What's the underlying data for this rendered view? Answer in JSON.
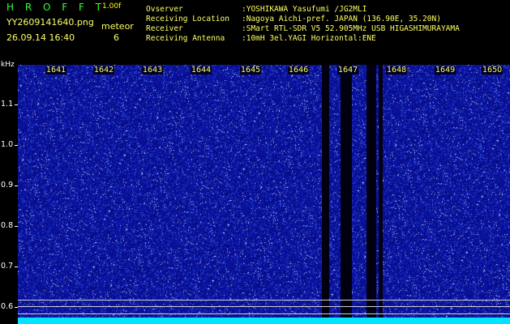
{
  "header": {
    "app_title": "H R O F F T",
    "app_version": "1.00f",
    "file_name": "YY2609141640.png",
    "detect_label": "meteor",
    "detect_count": "6",
    "time_stamp": "26.09.14 16:40"
  },
  "info": [
    {
      "label": "Ovserver",
      "value": ":YOSHIKAWA Yasufumi /JG2MLI"
    },
    {
      "label": "Receiving Location",
      "value": ":Nagoya Aichi-pref. JAPAN (136.90E, 35.20N)"
    },
    {
      "label": "Receiver",
      "value": ":SMart RTL-SDR V5 52.905MHz USB HIGASHIMURAYAMA"
    },
    {
      "label": "Receiving Antenna",
      "value": ":10mH 3el.YAGI Horizontal:ENE"
    }
  ],
  "axis": {
    "unit": "kHz",
    "y_ticks": [
      "1.1",
      "1.0",
      "0.9",
      "0.8",
      "0.7",
      "0.6"
    ],
    "x_ticks": [
      "1641",
      "1642",
      "1643",
      "1644",
      "1645",
      "1646",
      "1647",
      "1648",
      "1649",
      "1650"
    ]
  },
  "colors": {
    "background": "#000000",
    "spectrum": "#0a0f9a",
    "text_yellow": "#ffff66",
    "title_green": "#33ff33",
    "baseline": "#00e5ff"
  }
}
